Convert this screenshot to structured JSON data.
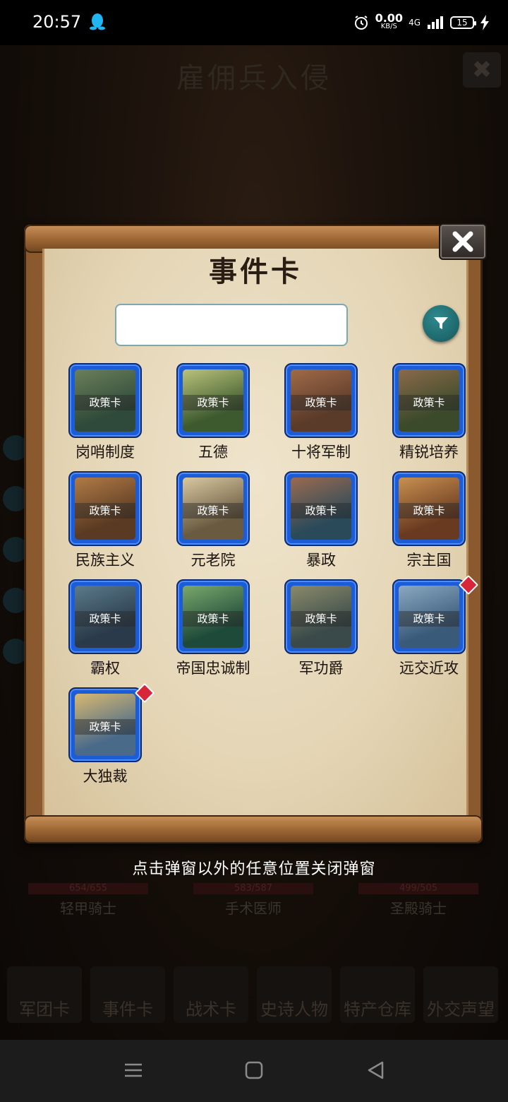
{
  "status_bar": {
    "time": "20:57",
    "net_speed": "0.00",
    "net_unit": "KB/S",
    "network": "4G",
    "battery": "15"
  },
  "background": {
    "title": "雇佣兵入侵",
    "units": [
      {
        "hp": "654/655",
        "name": "轻甲骑士"
      },
      {
        "hp": "583/587",
        "name": "手术医师"
      },
      {
        "hp": "499/505",
        "name": "圣殿骑士"
      }
    ],
    "tabs": [
      "军团卡",
      "事件卡",
      "战术卡",
      "史诗人物",
      "特产仓库",
      "外交声望"
    ]
  },
  "dialog": {
    "title": "事件卡",
    "search": {
      "value": "",
      "placeholder": ""
    },
    "cards": [
      {
        "tag": "政策卡",
        "name": "岗哨制度",
        "art": [
          "#2f4a3a",
          "#6b7f5a"
        ],
        "is_new": false
      },
      {
        "tag": "政策卡",
        "name": "五德",
        "art": [
          "#3d5a2e",
          "#b9c27a"
        ],
        "is_new": false
      },
      {
        "tag": "政策卡",
        "name": "十将军制",
        "art": [
          "#5a3a28",
          "#a06a48"
        ],
        "is_new": false
      },
      {
        "tag": "政策卡",
        "name": "精锐培养",
        "art": [
          "#3a4a2a",
          "#8a6a4a"
        ],
        "is_new": false
      },
      {
        "tag": "政策卡",
        "name": "民族主义",
        "art": [
          "#5a3a22",
          "#b07a46"
        ],
        "is_new": false
      },
      {
        "tag": "政策卡",
        "name": "元老院",
        "art": [
          "#6a5a40",
          "#d8c8a0"
        ],
        "is_new": false
      },
      {
        "tag": "政策卡",
        "name": "暴政",
        "art": [
          "#2a4a5a",
          "#9a6a50"
        ],
        "is_new": false
      },
      {
        "tag": "政策卡",
        "name": "宗主国",
        "art": [
          "#6a3a20",
          "#c89050"
        ],
        "is_new": false
      },
      {
        "tag": "政策卡",
        "name": "霸权",
        "art": [
          "#2a3a4a",
          "#5a7a8a"
        ],
        "is_new": false
      },
      {
        "tag": "政策卡",
        "name": "帝国忠诚制",
        "art": [
          "#1e4a3a",
          "#7aa86a"
        ],
        "is_new": false
      },
      {
        "tag": "政策卡",
        "name": "军功爵",
        "art": [
          "#3a4a4a",
          "#8a8a6a"
        ],
        "is_new": false
      },
      {
        "tag": "政策卡",
        "name": "远交近攻",
        "art": [
          "#3a5a7a",
          "#8aa8c0"
        ],
        "is_new": true
      },
      {
        "tag": "政策卡",
        "name": "大独裁",
        "art": [
          "#4a6a8a",
          "#d8b870"
        ],
        "is_new": true
      }
    ]
  },
  "hint": "点击弹窗以外的任意位置关闭弹窗",
  "icons": {
    "status_qq": "qq-icon",
    "alarm": "alarm-icon",
    "signal": "signal-icon",
    "battery": "battery-icon",
    "charging": "bolt-icon",
    "filter": "filter-icon",
    "close": "close-icon",
    "nav_menu": "menu-icon",
    "nav_home": "home-icon",
    "nav_back": "back-icon"
  }
}
